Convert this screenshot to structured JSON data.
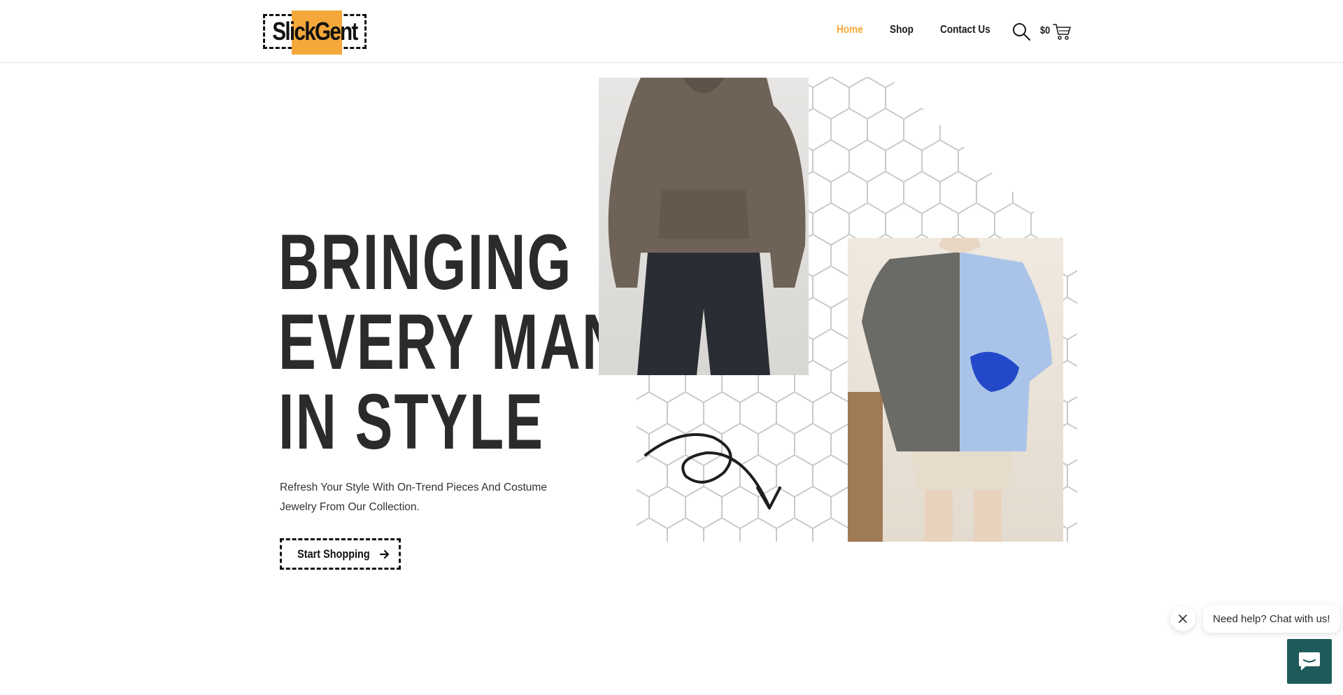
{
  "header": {
    "logo_text": "SlickGent",
    "nav": [
      {
        "label": "Home",
        "active": true
      },
      {
        "label": "Shop",
        "active": false
      },
      {
        "label": "Contact Us",
        "active": false
      }
    ],
    "cart_total": "$0",
    "icons": {
      "search": "search-icon",
      "cart": "cart-icon"
    }
  },
  "hero": {
    "title_lines": [
      "BRINGING",
      "EVERY MAN",
      "IN STYLE"
    ],
    "subtitle": "Refresh Your Style With On-Trend Pieces And Costume Jewelry From Our Collection.",
    "cta_label": "Start Shopping",
    "cta_icon": "arrow-right-icon"
  },
  "chat": {
    "message": "Need help? Chat with us!",
    "close_icon": "close-icon",
    "chat_icon": "chat-icon"
  },
  "colors": {
    "accent": "#f4a83a",
    "text": "#2b2b2b",
    "chat_button": "#1f5a5a",
    "border": "#e6e6e6"
  }
}
